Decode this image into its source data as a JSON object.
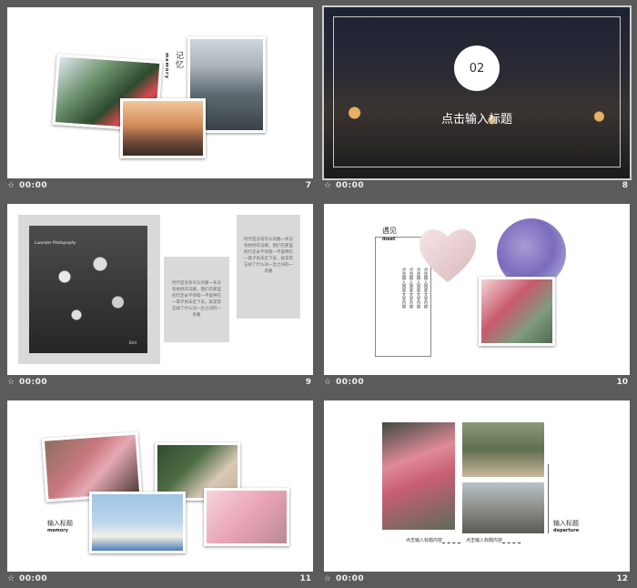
{
  "slides": [
    {
      "number": "7",
      "time": "00:00",
      "title": "记忆",
      "subtitle": "memory"
    },
    {
      "number": "8",
      "time": "00:00",
      "badge": "02",
      "title": "点击输入标题"
    },
    {
      "number": "9",
      "time": "00:00",
      "photo_caption": "Lavender Photography",
      "photo_tag": "Bird",
      "body": "时代是没有尽头的路一条没有始终的马路，我们在那里的行走永不停歇一不留神在一辈子尚未走下去，就常常忘却了什么叫一念之间的一条路"
    },
    {
      "number": "10",
      "time": "00:00",
      "title": "遇见",
      "subtitle": "meet",
      "columns": [
        "点击输入简要文字内容",
        "点击输入简要文字内容",
        "点击输入简要文字内容",
        "点击输入简要文字内容"
      ]
    },
    {
      "number": "11",
      "time": "00:00",
      "title": "输入标题",
      "subtitle": "memory"
    },
    {
      "number": "12",
      "time": "00:00",
      "title": "输入标题",
      "subtitle": "departure",
      "caption_left": "点击输入标题内容",
      "caption_right": "点击输入标题内容"
    }
  ],
  "footer": {
    "star_icon": "☆"
  },
  "colors": {
    "background": "#5b5b5b",
    "slide": "#ffffff",
    "grey_box": "#d9d9d9"
  }
}
